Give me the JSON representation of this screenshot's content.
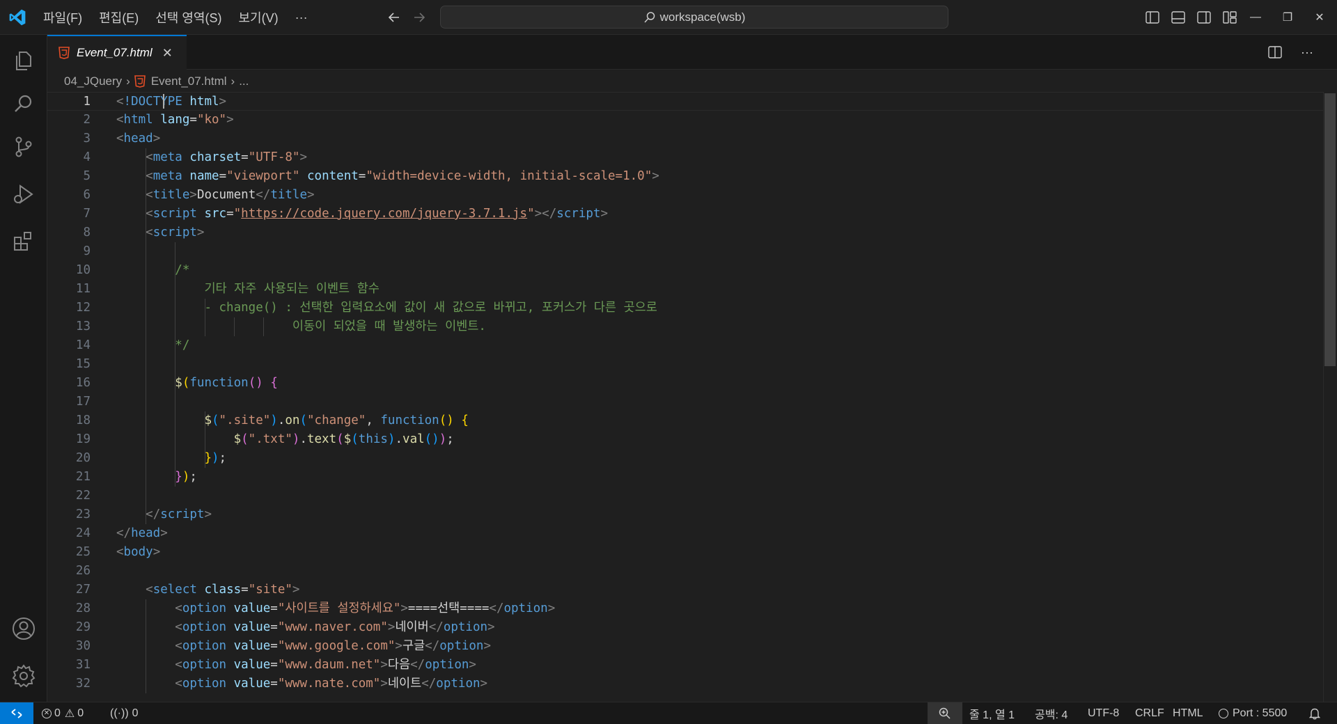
{
  "titlebar": {
    "menus": [
      "파일(F)",
      "편집(E)",
      "선택 영역(S)",
      "보기(V)",
      "···"
    ],
    "search_text": "workspace(wsb)"
  },
  "tab": {
    "filename": "Event_07.html",
    "close_glyph": "✕"
  },
  "breadcrumb": {
    "folder": "04_JQuery",
    "file": "Event_07.html",
    "more": "..."
  },
  "editor": {
    "current_line": 1,
    "lines": [
      [
        [
          "t-br",
          "<"
        ],
        [
          "t-tag",
          "!DOCTYPE"
        ],
        [
          "t-text",
          " "
        ],
        [
          "t-attr",
          "html"
        ],
        [
          "t-br",
          ">"
        ]
      ],
      [
        [
          "t-br",
          "<"
        ],
        [
          "t-tag",
          "html"
        ],
        [
          "t-text",
          " "
        ],
        [
          "t-attr",
          "lang"
        ],
        [
          "t-text",
          "="
        ],
        [
          "t-str",
          "\"ko\""
        ],
        [
          "t-br",
          ">"
        ]
      ],
      [
        [
          "t-br",
          "<"
        ],
        [
          "t-tag",
          "head"
        ],
        [
          "t-br",
          ">"
        ]
      ],
      [
        [
          "t-text",
          "    "
        ],
        [
          "t-br",
          "<"
        ],
        [
          "t-tag",
          "meta"
        ],
        [
          "t-text",
          " "
        ],
        [
          "t-attr",
          "charset"
        ],
        [
          "t-text",
          "="
        ],
        [
          "t-str",
          "\"UTF-8\""
        ],
        [
          "t-br",
          ">"
        ]
      ],
      [
        [
          "t-text",
          "    "
        ],
        [
          "t-br",
          "<"
        ],
        [
          "t-tag",
          "meta"
        ],
        [
          "t-text",
          " "
        ],
        [
          "t-attr",
          "name"
        ],
        [
          "t-text",
          "="
        ],
        [
          "t-str",
          "\"viewport\""
        ],
        [
          "t-text",
          " "
        ],
        [
          "t-attr",
          "content"
        ],
        [
          "t-text",
          "="
        ],
        [
          "t-str",
          "\"width=device-width, initial-scale=1.0\""
        ],
        [
          "t-br",
          ">"
        ]
      ],
      [
        [
          "t-text",
          "    "
        ],
        [
          "t-br",
          "<"
        ],
        [
          "t-tag",
          "title"
        ],
        [
          "t-br",
          ">"
        ],
        [
          "t-text",
          "Document"
        ],
        [
          "t-br",
          "</"
        ],
        [
          "t-tag",
          "title"
        ],
        [
          "t-br",
          ">"
        ]
      ],
      [
        [
          "t-text",
          "    "
        ],
        [
          "t-br",
          "<"
        ],
        [
          "t-tag",
          "script"
        ],
        [
          "t-text",
          " "
        ],
        [
          "t-attr",
          "src"
        ],
        [
          "t-text",
          "="
        ],
        [
          "t-str",
          "\""
        ],
        [
          "t-link",
          "https://code.jquery.com/jquery-3.7.1.js"
        ],
        [
          "t-str",
          "\""
        ],
        [
          "t-br",
          "></"
        ],
        [
          "t-tag",
          "script"
        ],
        [
          "t-br",
          ">"
        ]
      ],
      [
        [
          "t-text",
          "    "
        ],
        [
          "t-br",
          "<"
        ],
        [
          "t-tag",
          "script"
        ],
        [
          "t-br",
          ">"
        ]
      ],
      [],
      [
        [
          "t-text",
          "        "
        ],
        [
          "t-com",
          "/*"
        ]
      ],
      [
        [
          "t-text",
          "        "
        ],
        [
          "t-com",
          "    기타 자주 사용되는 이벤트 함수"
        ]
      ],
      [
        [
          "t-text",
          "        "
        ],
        [
          "t-com",
          "    - change() : 선택한 입력요소에 값이 새 값으로 바뀌고, 포커스가 다른 곳으로"
        ]
      ],
      [
        [
          "t-text",
          "        "
        ],
        [
          "t-com",
          "                이동이 되었을 때 발생하는 이벤트."
        ]
      ],
      [
        [
          "t-text",
          "        "
        ],
        [
          "t-com",
          "*/"
        ]
      ],
      [],
      [
        [
          "t-text",
          "        "
        ],
        [
          "t-fn",
          "$"
        ],
        [
          "t-y",
          "("
        ],
        [
          "t-kw",
          "function"
        ],
        [
          "t-p",
          "()"
        ],
        [
          "t-text",
          " "
        ],
        [
          "t-p",
          "{"
        ]
      ],
      [],
      [
        [
          "t-text",
          "            "
        ],
        [
          "t-fn",
          "$"
        ],
        [
          "t-b",
          "("
        ],
        [
          "t-str",
          "\".site\""
        ],
        [
          "t-b",
          ")"
        ],
        [
          "t-text",
          "."
        ],
        [
          "t-fn",
          "on"
        ],
        [
          "t-b",
          "("
        ],
        [
          "t-str",
          "\"change\""
        ],
        [
          "t-text",
          ", "
        ],
        [
          "t-kw",
          "function"
        ],
        [
          "t-y",
          "()"
        ],
        [
          "t-text",
          " "
        ],
        [
          "t-y",
          "{"
        ]
      ],
      [
        [
          "t-text",
          "                "
        ],
        [
          "t-fn",
          "$"
        ],
        [
          "t-p",
          "("
        ],
        [
          "t-str",
          "\".txt\""
        ],
        [
          "t-p",
          ")"
        ],
        [
          "t-text",
          "."
        ],
        [
          "t-fn",
          "text"
        ],
        [
          "t-p",
          "("
        ],
        [
          "t-fn",
          "$"
        ],
        [
          "t-b",
          "("
        ],
        [
          "t-kw",
          "this"
        ],
        [
          "t-b",
          ")"
        ],
        [
          "t-text",
          "."
        ],
        [
          "t-fn",
          "val"
        ],
        [
          "t-b",
          "()"
        ],
        [
          "t-p",
          ")"
        ],
        [
          "t-text",
          ";"
        ]
      ],
      [
        [
          "t-text",
          "            "
        ],
        [
          "t-y",
          "}"
        ],
        [
          "t-b",
          ")"
        ],
        [
          "t-text",
          ";"
        ]
      ],
      [
        [
          "t-text",
          "        "
        ],
        [
          "t-p",
          "}"
        ],
        [
          "t-y",
          ")"
        ],
        [
          "t-text",
          ";"
        ]
      ],
      [],
      [
        [
          "t-text",
          "    "
        ],
        [
          "t-br",
          "</"
        ],
        [
          "t-tag",
          "script"
        ],
        [
          "t-br",
          ">"
        ]
      ],
      [
        [
          "t-br",
          "</"
        ],
        [
          "t-tag",
          "head"
        ],
        [
          "t-br",
          ">"
        ]
      ],
      [
        [
          "t-br",
          "<"
        ],
        [
          "t-tag",
          "body"
        ],
        [
          "t-br",
          ">"
        ]
      ],
      [],
      [
        [
          "t-text",
          "    "
        ],
        [
          "t-br",
          "<"
        ],
        [
          "t-tag",
          "select"
        ],
        [
          "t-text",
          " "
        ],
        [
          "t-attr",
          "class"
        ],
        [
          "t-text",
          "="
        ],
        [
          "t-str",
          "\"site\""
        ],
        [
          "t-br",
          ">"
        ]
      ],
      [
        [
          "t-text",
          "        "
        ],
        [
          "t-br",
          "<"
        ],
        [
          "t-tag",
          "option"
        ],
        [
          "t-text",
          " "
        ],
        [
          "t-attr",
          "value"
        ],
        [
          "t-text",
          "="
        ],
        [
          "t-str",
          "\"사이트를 설정하세요\""
        ],
        [
          "t-br",
          ">"
        ],
        [
          "t-text",
          "====선택===="
        ],
        [
          "t-br",
          "</"
        ],
        [
          "t-tag",
          "option"
        ],
        [
          "t-br",
          ">"
        ]
      ],
      [
        [
          "t-text",
          "        "
        ],
        [
          "t-br",
          "<"
        ],
        [
          "t-tag",
          "option"
        ],
        [
          "t-text",
          " "
        ],
        [
          "t-attr",
          "value"
        ],
        [
          "t-text",
          "="
        ],
        [
          "t-str",
          "\"www.naver.com\""
        ],
        [
          "t-br",
          ">"
        ],
        [
          "t-text",
          "네이버"
        ],
        [
          "t-br",
          "</"
        ],
        [
          "t-tag",
          "option"
        ],
        [
          "t-br",
          ">"
        ]
      ],
      [
        [
          "t-text",
          "        "
        ],
        [
          "t-br",
          "<"
        ],
        [
          "t-tag",
          "option"
        ],
        [
          "t-text",
          " "
        ],
        [
          "t-attr",
          "value"
        ],
        [
          "t-text",
          "="
        ],
        [
          "t-str",
          "\"www.google.com\""
        ],
        [
          "t-br",
          ">"
        ],
        [
          "t-text",
          "구글"
        ],
        [
          "t-br",
          "</"
        ],
        [
          "t-tag",
          "option"
        ],
        [
          "t-br",
          ">"
        ]
      ],
      [
        [
          "t-text",
          "        "
        ],
        [
          "t-br",
          "<"
        ],
        [
          "t-tag",
          "option"
        ],
        [
          "t-text",
          " "
        ],
        [
          "t-attr",
          "value"
        ],
        [
          "t-text",
          "="
        ],
        [
          "t-str",
          "\"www.daum.net\""
        ],
        [
          "t-br",
          ">"
        ],
        [
          "t-text",
          "다음"
        ],
        [
          "t-br",
          "</"
        ],
        [
          "t-tag",
          "option"
        ],
        [
          "t-br",
          ">"
        ]
      ],
      [
        [
          "t-text",
          "        "
        ],
        [
          "t-br",
          "<"
        ],
        [
          "t-tag",
          "option"
        ],
        [
          "t-text",
          " "
        ],
        [
          "t-attr",
          "value"
        ],
        [
          "t-text",
          "="
        ],
        [
          "t-str",
          "\"www.nate.com\""
        ],
        [
          "t-br",
          ">"
        ],
        [
          "t-text",
          "네이트"
        ],
        [
          "t-br",
          "</"
        ],
        [
          "t-tag",
          "option"
        ],
        [
          "t-br",
          ">"
        ]
      ]
    ]
  },
  "statusbar": {
    "errors": "0",
    "warnings": "0",
    "ports": "0",
    "position": "줄 1, 열 1",
    "spaces": "공백: 4",
    "encoding": "UTF-8",
    "eol": "CRLF",
    "language": "HTML",
    "port": "Port : 5500"
  },
  "colors": {
    "accent": "#0078d4",
    "background": "#1f1f1f",
    "html_icon": "#e44d26"
  }
}
